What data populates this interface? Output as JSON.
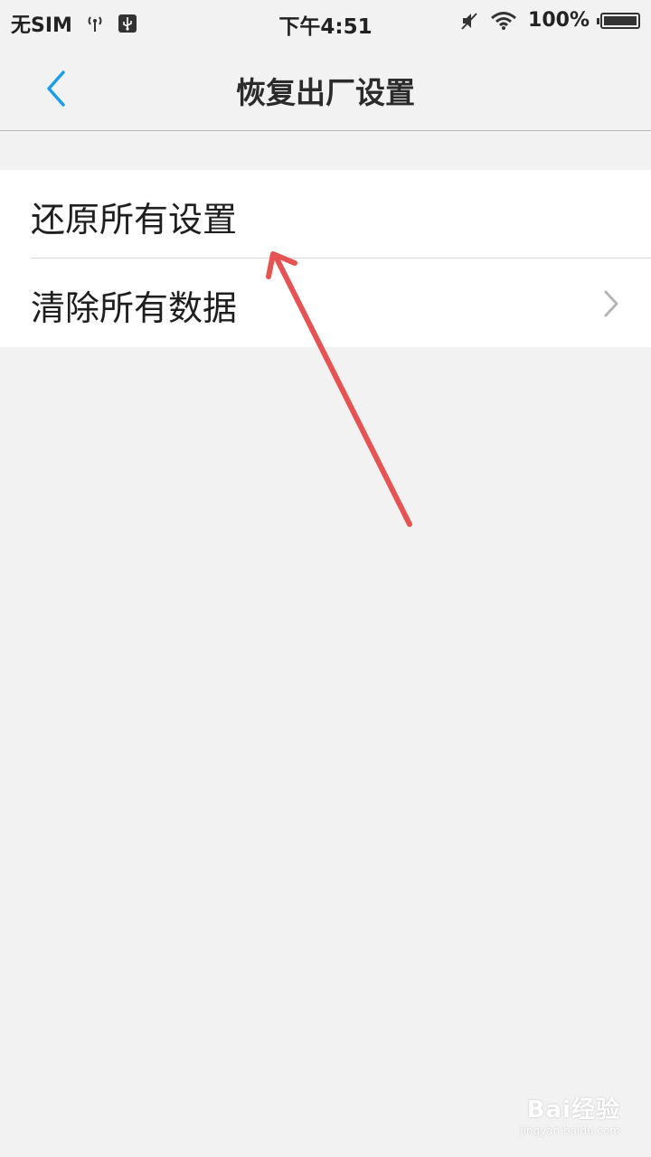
{
  "status_bar": {
    "carrier": "无SIM",
    "time": "下午4:51",
    "battery_text": "100%",
    "icons": [
      "signal-antenna-icon",
      "usb-icon",
      "mute-icon",
      "wifi-icon",
      "battery-icon"
    ]
  },
  "header": {
    "title": "恢复出厂设置",
    "back_icon": "chevron-left-icon"
  },
  "list": {
    "items": [
      {
        "label": "还原所有设置",
        "has_chevron": false
      },
      {
        "label": "清除所有数据",
        "has_chevron": true
      }
    ]
  },
  "watermark": {
    "text": "Bai经验",
    "subtext": "jingyan.baidu.com"
  },
  "colors": {
    "background": "#f2f2f2",
    "accent": "#1a9ee8",
    "arrow": "#e55353"
  }
}
